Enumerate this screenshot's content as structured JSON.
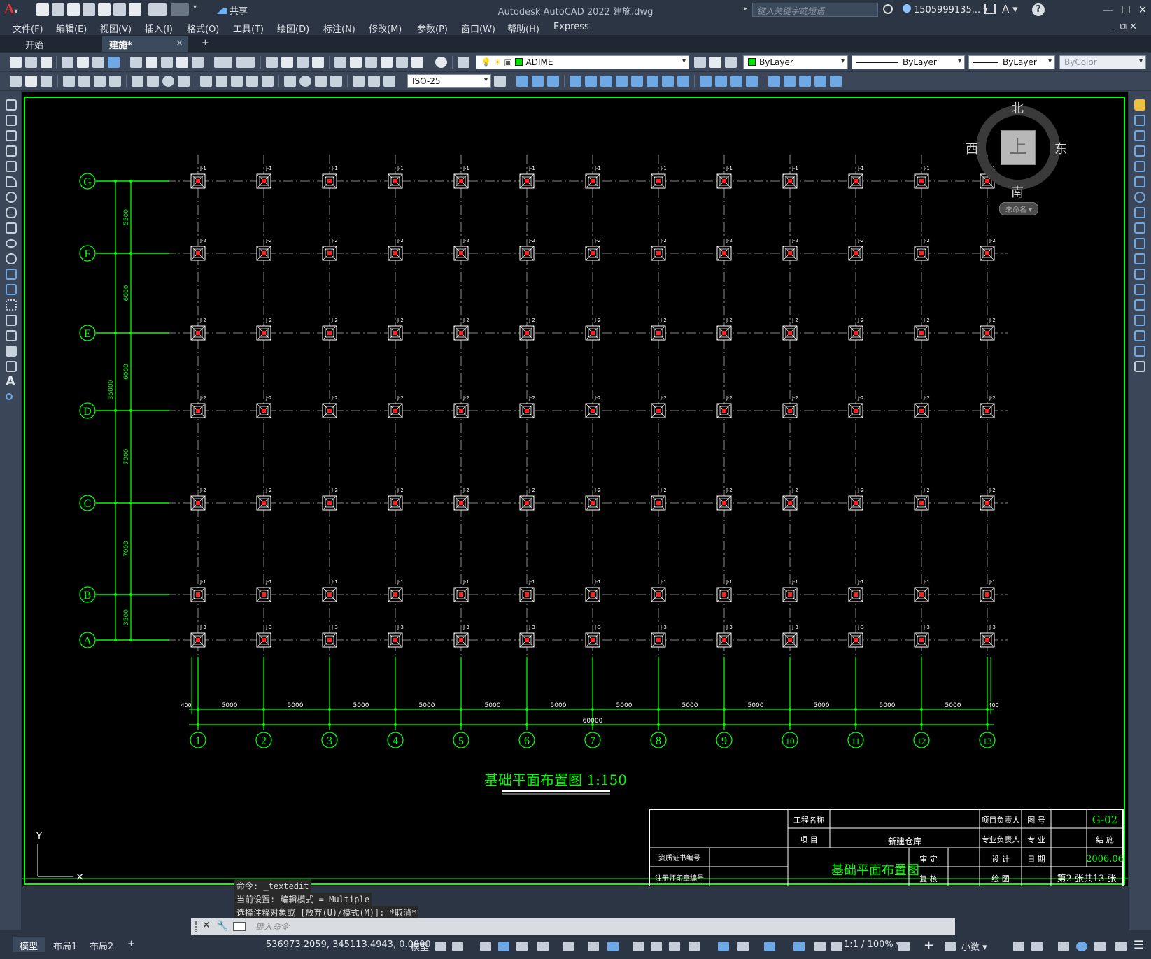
{
  "app": {
    "window_title": "Autodesk AutoCAD 2022    建施.dwg",
    "share_label": "共享",
    "search_placeholder": "键入关键字或短语",
    "user": "1505999135...",
    "help": "?"
  },
  "menu": [
    "文件(F)",
    "编辑(E)",
    "视图(V)",
    "插入(I)",
    "格式(O)",
    "工具(T)",
    "绘图(D)",
    "标注(N)",
    "修改(M)",
    "参数(P)",
    "窗口(W)",
    "帮助(H)",
    "Express"
  ],
  "tabs": [
    {
      "label": "开始"
    },
    {
      "label": "建施*"
    }
  ],
  "toolbar": {
    "layer": "ADIME",
    "color": "ByLayer",
    "linetype": "ByLayer",
    "lineweight": "ByLayer",
    "plotstyle": "ByColor",
    "dimstyle": "ISO-25",
    "layer_color": "#00e000"
  },
  "viewcube": {
    "north": "北",
    "south": "南",
    "east": "东",
    "west": "西",
    "top": "上",
    "ucs": "未命名 ▾"
  },
  "drawing": {
    "row_axes": [
      "G",
      "F",
      "E",
      "D",
      "C",
      "B",
      "A"
    ],
    "col_axes": [
      "1",
      "2",
      "3",
      "4",
      "5",
      "6",
      "7",
      "8",
      "9",
      "10",
      "11",
      "12",
      "13"
    ],
    "row_footing_tags": [
      "J-1",
      "J-2",
      "J-2",
      "J-2",
      "J-2",
      "J-1",
      "J-3"
    ],
    "row_spacing_labels": [
      "5500",
      "6000",
      "6000",
      "7000",
      "7000",
      "3500"
    ],
    "total_height_label": "35000",
    "col_spacing_labels": [
      "5000",
      "5000",
      "5000",
      "5000",
      "5000",
      "5000",
      "5000",
      "5000",
      "5000",
      "5000",
      "5000",
      "5000"
    ],
    "edge_offset_label": "400",
    "total_width_label": "60000",
    "drawing_title": "基础平面布置图 1:150",
    "axis_color": "#00ff00",
    "grid_color": "#b0b0b0",
    "column_color": "#ff2020"
  },
  "title_block": {
    "project_name_label": "工程名称",
    "item_label": "项  目",
    "item_value": "新建仓库",
    "drawing_name": "基础平面布置图",
    "project_lead": "项目负责人",
    "discipline_lead": "专业负责人",
    "design": "设 计",
    "draw": "绘 图",
    "review": "审 定",
    "check": "复 核",
    "cert_no": "资质证书编号",
    "seal_no": "注册师印章编号",
    "drawing_no_label": "图 号",
    "drawing_no": "G-02",
    "discipline_label": "专 业",
    "discipline": "结 施",
    "date_label": "日 期",
    "date": "2006.06",
    "sheet": "第2 张共13 张"
  },
  "ucs": {
    "y": "Y"
  },
  "command": {
    "history": [
      "命令: _textedit",
      "当前设置: 编辑模式 = Multiple",
      "选择注释对象或 [放弃(U)/模式(M)]: *取消*"
    ],
    "placeholder": "键入命令"
  },
  "status": {
    "layouts": [
      "模型",
      "布局1",
      "布局2"
    ],
    "add_layout": "+",
    "coords": "536973.2059, 345113.4943, 0.0000",
    "space": "模型",
    "scale": "1:1 / 100%",
    "units": "小数"
  }
}
